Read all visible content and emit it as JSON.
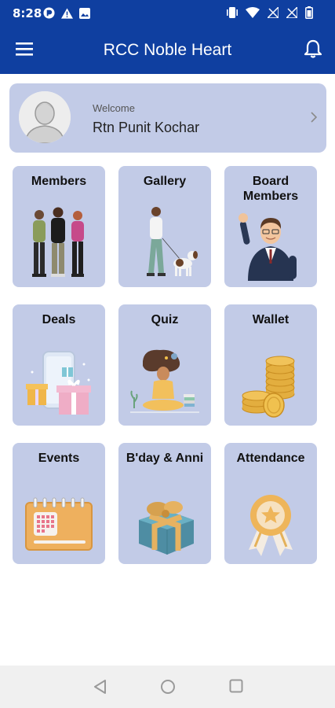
{
  "status_bar": {
    "time": "8:28",
    "left_icons": [
      "app-notification-icon",
      "warning-icon",
      "image-icon"
    ],
    "right_icons": [
      "vibrate-icon",
      "wifi-icon",
      "signal-off-icon",
      "signal-off-icon",
      "battery-icon"
    ]
  },
  "app_bar": {
    "title": "RCC Noble Heart",
    "menu_icon": "hamburger-menu-icon",
    "notification_icon": "bell-icon"
  },
  "profile": {
    "greeting": "Welcome",
    "name": "Rtn Punit Kochar"
  },
  "tiles": [
    {
      "label": "Members",
      "icon": "members-group-illustration"
    },
    {
      "label": "Gallery",
      "icon": "man-with-dog-illustration"
    },
    {
      "label": "Board\nMembers",
      "icon": "businessman-waving-illustration"
    },
    {
      "label": "Deals",
      "icon": "phone-gift-boxes-illustration"
    },
    {
      "label": "Quiz",
      "icon": "thinking-person-illustration"
    },
    {
      "label": "Wallet",
      "icon": "coin-stacks-illustration"
    },
    {
      "label": "Events",
      "icon": "calendar-illustration"
    },
    {
      "label": "B'day & Anni",
      "icon": "gift-box-illustration"
    },
    {
      "label": "Attendance",
      "icon": "award-badge-illustration"
    }
  ],
  "colors": {
    "primary": "#0f3fa0",
    "tile_bg": "#c2cbe7",
    "page_bg": "#ffffff",
    "nav_bar_bg": "#f0f0f0"
  },
  "system_nav": [
    "back-icon",
    "home-icon",
    "recents-icon"
  ]
}
